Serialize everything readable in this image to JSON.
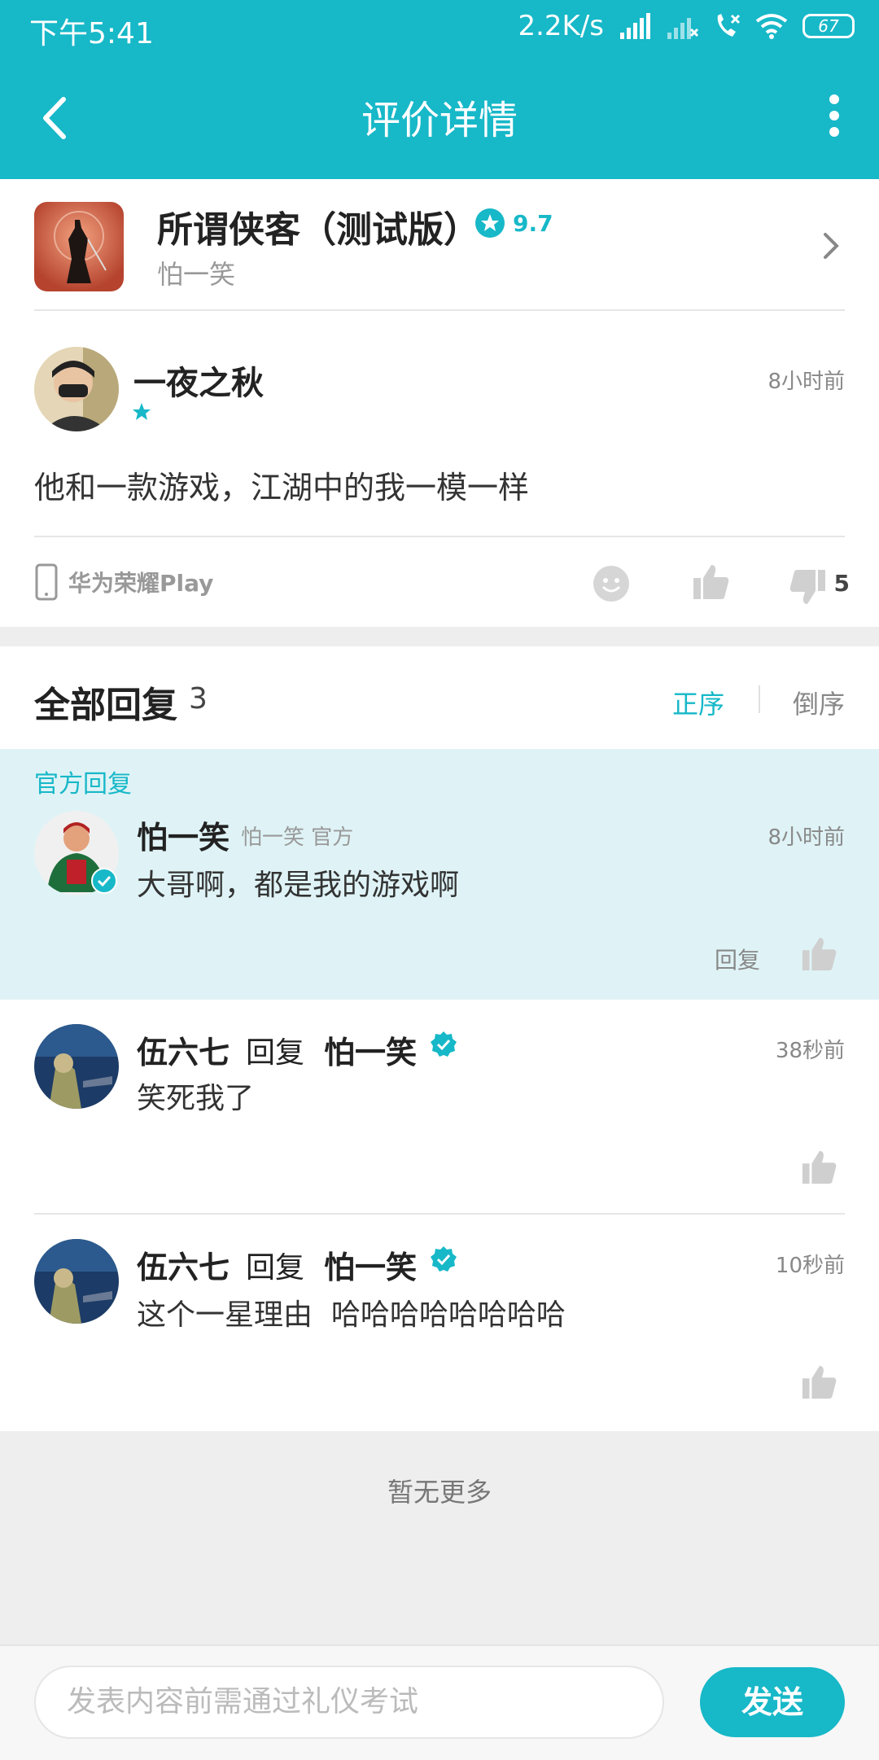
{
  "status_bar": {
    "time": "下午5:41",
    "net_speed": "2.2K/s",
    "battery": "67"
  },
  "header": {
    "title": "评价详情"
  },
  "app": {
    "name": "所谓侠客（测试版）",
    "rating": "9.7",
    "developer": "怕一笑"
  },
  "review": {
    "user": "一夜之秋",
    "time": "8小时前",
    "stars": 1,
    "content": "他和一款游戏，江湖中的我一模一样",
    "device": "华为荣耀Play",
    "dislike_count": "5"
  },
  "replies": {
    "title": "全部回复",
    "count": "3",
    "sort_asc": "正序",
    "sort_desc": "倒序",
    "official": {
      "label": "官方回复",
      "user": "怕一笑",
      "meta": "怕一笑 官方",
      "time": "8小时前",
      "content": "大哥啊，都是我的游戏啊",
      "reply_label": "回复"
    },
    "items": [
      {
        "user": "伍六七",
        "reply_word": "回复",
        "target": "怕一笑",
        "time": "38秒前",
        "content": "笑死我了"
      },
      {
        "user": "伍六七",
        "reply_word": "回复",
        "target": "怕一笑",
        "time": "10秒前",
        "content": "这个一星理由  哈哈哈哈哈哈哈哈"
      }
    ],
    "no_more": "暂无更多"
  },
  "composer": {
    "placeholder": "发表内容前需通过礼仪考试",
    "send_label": "发送"
  },
  "colors": {
    "accent": "#17b8c8",
    "official_bg": "#dff3f6"
  }
}
